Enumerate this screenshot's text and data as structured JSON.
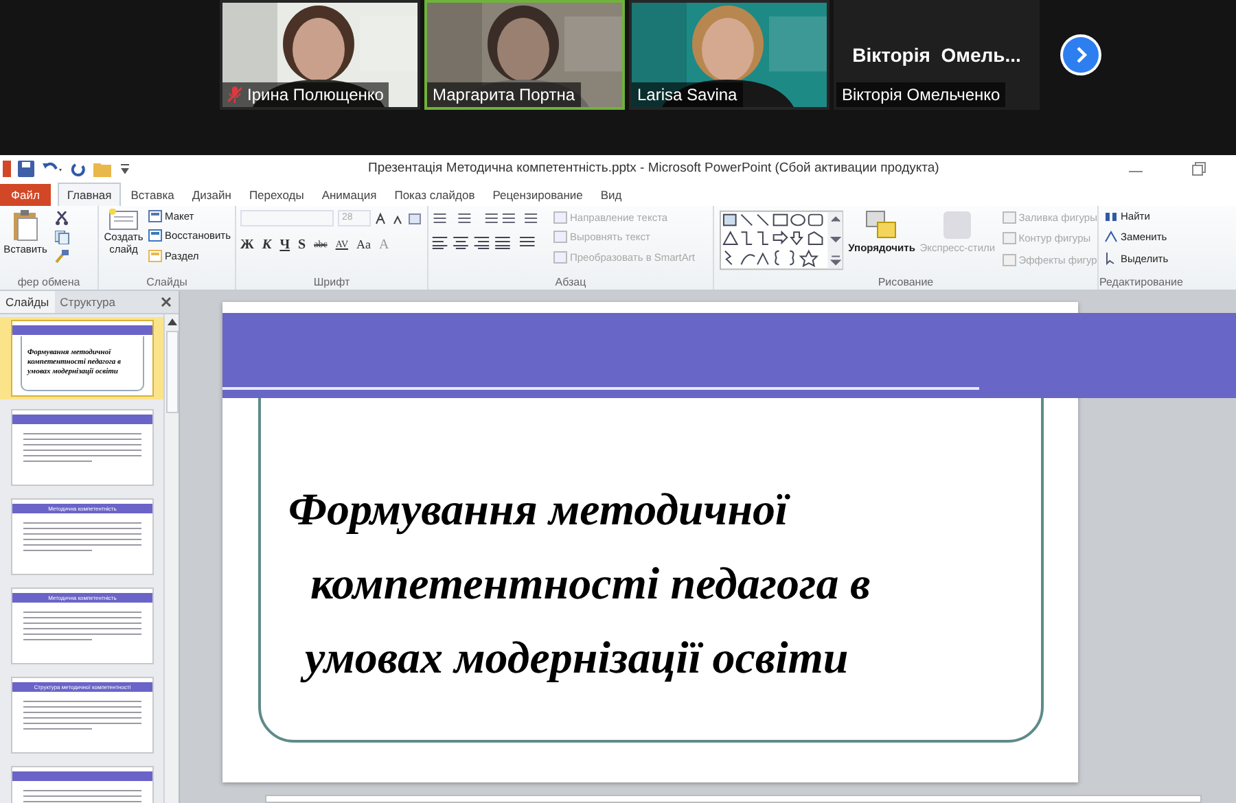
{
  "meeting": {
    "participants": [
      {
        "name": "Ірина Полющенко",
        "kind": "video",
        "muted": true,
        "speaking": false
      },
      {
        "name": "Маргарита Портна",
        "kind": "video",
        "muted": false,
        "speaking": true
      },
      {
        "name": "Larisa Savina",
        "kind": "video",
        "muted": false,
        "speaking": false
      },
      {
        "name": "Вікторія Омельченко",
        "kind": "name",
        "display": "Вікторія  Омель...",
        "muted": false,
        "speaking": false
      }
    ]
  },
  "window": {
    "title": "Презентація Методична компетентність.pptx - Microsoft PowerPoint (Сбой активации продукта)"
  },
  "tabs": [
    {
      "label": "Файл",
      "kind": "file",
      "selected": false
    },
    {
      "label": "Главная",
      "kind": "tab",
      "selected": true
    },
    {
      "label": "Вставка",
      "kind": "tab",
      "selected": false
    },
    {
      "label": "Дизайн",
      "kind": "tab",
      "selected": false
    },
    {
      "label": "Переходы",
      "kind": "tab",
      "selected": false
    },
    {
      "label": "Анимация",
      "kind": "tab",
      "selected": false
    },
    {
      "label": "Показ слайдов",
      "kind": "tab",
      "selected": false
    },
    {
      "label": "Рецензирование",
      "kind": "tab",
      "selected": false
    },
    {
      "label": "Вид",
      "kind": "tab",
      "selected": false
    }
  ],
  "ribbon": {
    "clipboard": {
      "label": "фер обмена",
      "paste": "Вставить"
    },
    "slides": {
      "label": "Слайды",
      "new_slide": "Создать слайд",
      "items": [
        "Макет",
        "Восстановить",
        "Раздел"
      ]
    },
    "font": {
      "label": "Шрифт",
      "size": "28",
      "buttons": [
        "Ж",
        "К",
        "Ч",
        "S",
        "abc",
        "AV",
        "Aa",
        "A"
      ]
    },
    "paragraph": {
      "label": "Абзац",
      "items": [
        {
          "label": "Направление текста",
          "disabled": true
        },
        {
          "label": "Выровнять текст",
          "disabled": true
        },
        {
          "label": "Преобразовать в SmartArt",
          "disabled": true
        }
      ]
    },
    "drawing": {
      "label": "Рисование",
      "arrange": "Упорядочить",
      "quick_styles": {
        "label": "Экспресс-стили",
        "disabled": true
      },
      "items": [
        {
          "label": "Заливка фигуры",
          "disabled": true
        },
        {
          "label": "Контур фигуры",
          "disabled": true
        },
        {
          "label": "Эффекты фигур",
          "disabled": true
        }
      ]
    },
    "editing": {
      "label": "Редактирование",
      "items": [
        "Найти",
        "Заменить",
        "Выделить"
      ]
    }
  },
  "pane": {
    "tabs": [
      {
        "label": "Слайды",
        "selected": true
      },
      {
        "label": "Структура",
        "selected": false
      }
    ],
    "thumbnails": [
      {
        "kind": "title",
        "title": "Формування методичної компетентності педагога в умовах модернізації освіти",
        "selected": true
      },
      {
        "kind": "content",
        "selected": false
      },
      {
        "kind": "content",
        "title": "Методична компетентність",
        "selected": false
      },
      {
        "kind": "content",
        "title": "Методична компетентність",
        "selected": false
      },
      {
        "kind": "content",
        "title": "Структура методичної компетентності",
        "selected": false
      },
      {
        "kind": "content",
        "selected": false
      }
    ]
  },
  "slide": {
    "title_lines": [
      "Формування методичної",
      "компетентності педагога в",
      "умовах модернізації освіти"
    ]
  }
}
